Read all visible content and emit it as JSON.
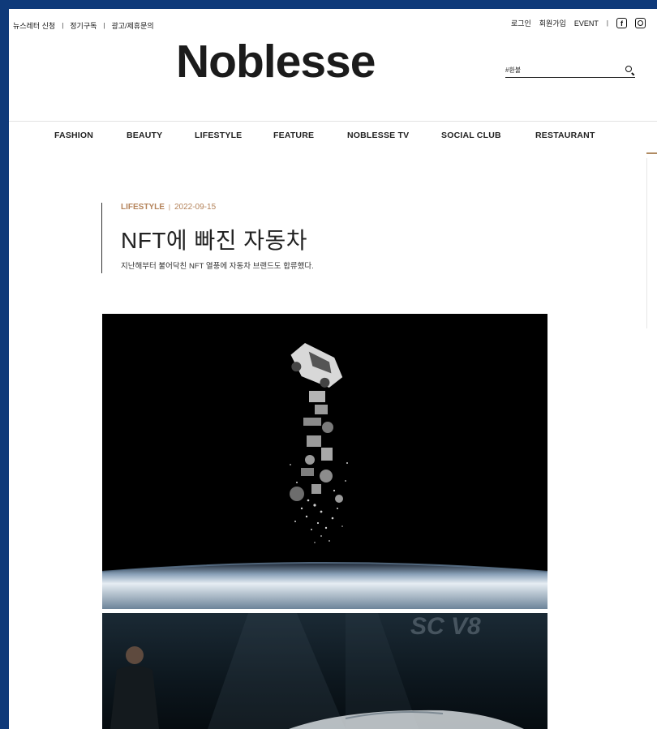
{
  "utility": {
    "left": [
      "뉴스레터 신청",
      "정기구독",
      "광고/제휴문의"
    ],
    "right": [
      "로그인",
      "회원가입",
      "EVENT"
    ],
    "sep": "|"
  },
  "logo": "Noblesse",
  "search": {
    "placeholder": "#환불"
  },
  "nav": [
    "FASHION",
    "BEAUTY",
    "LIFESTYLE",
    "FEATURE",
    "NOBLESSE TV",
    "SOCIAL CLUB",
    "RESTAURANT"
  ],
  "article": {
    "category": "LIFESTYLE",
    "pipe": "|",
    "date": "2022-09-15",
    "title": "NFT에 빠진 자동차",
    "subtitle": "지난해부터 불어닥친 NFT 열풍에 자동차 브랜드도 합류했다."
  },
  "image2": {
    "overlay_text": "SC V8"
  },
  "colors": {
    "accent": "#b4835a",
    "frame": "#0f3a7a",
    "text": "#222222"
  },
  "icons": [
    "facebook-icon",
    "instagram-icon",
    "search-icon"
  ]
}
